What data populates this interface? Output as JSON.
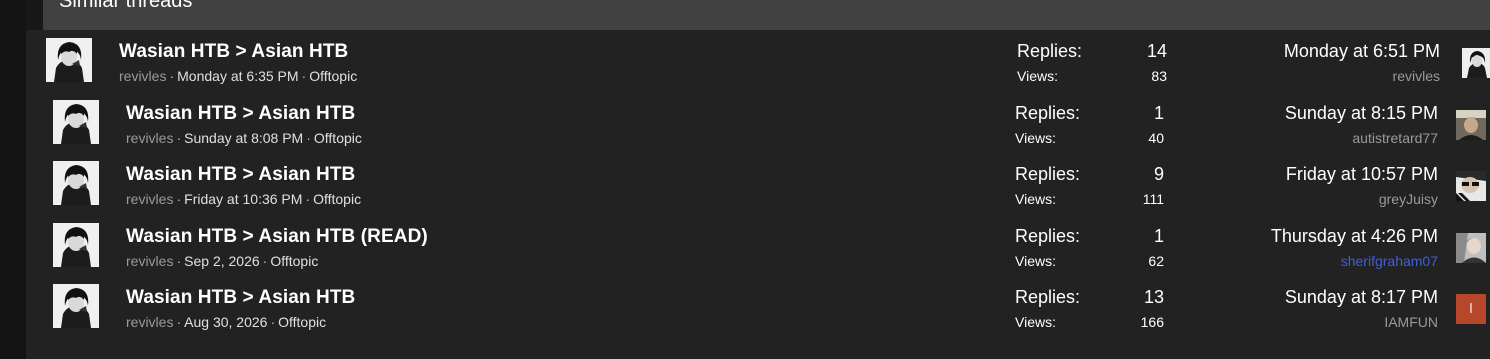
{
  "block_title": "Similar threads",
  "labels": {
    "replies": "Replies:",
    "views": "Views:"
  },
  "threads": [
    {
      "title": "Wasian HTB > Asian HTB",
      "author": "revivles",
      "started": "Monday at 6:35 PM",
      "forum": "Offtopic",
      "replies": "14",
      "views": "83",
      "last_date": "Monday at 6:51 PM",
      "last_user": "revivles",
      "last_avatar": "manga-portrait-avatar"
    },
    {
      "title": "Wasian HTB > Asian HTB",
      "author": "revivles",
      "started": "Sunday at 8:08 PM",
      "forum": "Offtopic",
      "replies": "1",
      "views": "40",
      "last_date": "Sunday at 8:15 PM",
      "last_user": "autistretard77",
      "last_avatar": "photo-avatar"
    },
    {
      "title": "Wasian HTB > Asian HTB",
      "author": "revivles",
      "started": "Friday at 10:36 PM",
      "forum": "Offtopic",
      "replies": "9",
      "views": "111",
      "last_date": "Friday at 10:57 PM",
      "last_user": "greyJuisy",
      "last_avatar": "photo-avatar"
    },
    {
      "title": "Wasian HTB > Asian HTB (READ)",
      "author": "revivles",
      "started": "Sep 2, 2026",
      "forum": "Offtopic",
      "replies": "1",
      "views": "62",
      "last_date": "Thursday at 4:26 PM",
      "last_user": "sherifgraham07",
      "last_user_color": "#3f5fd6",
      "last_avatar": "photo-avatar"
    },
    {
      "title": "Wasian HTB > Asian HTB",
      "author": "revivles",
      "started": "Aug 30, 2026",
      "forum": "Offtopic",
      "replies": "13",
      "views": "166",
      "last_date": "Sunday at 8:17 PM",
      "last_user": "IAMFUN",
      "last_avatar": "letter-avatar",
      "last_avatar_letter": "I",
      "last_avatar_color": "#b7472a"
    }
  ],
  "colors": {
    "header_bg": "#414141",
    "panel_bg": "#222222",
    "meta_gray": "#9a9a9a",
    "link_blue": "#3f5fd6"
  }
}
